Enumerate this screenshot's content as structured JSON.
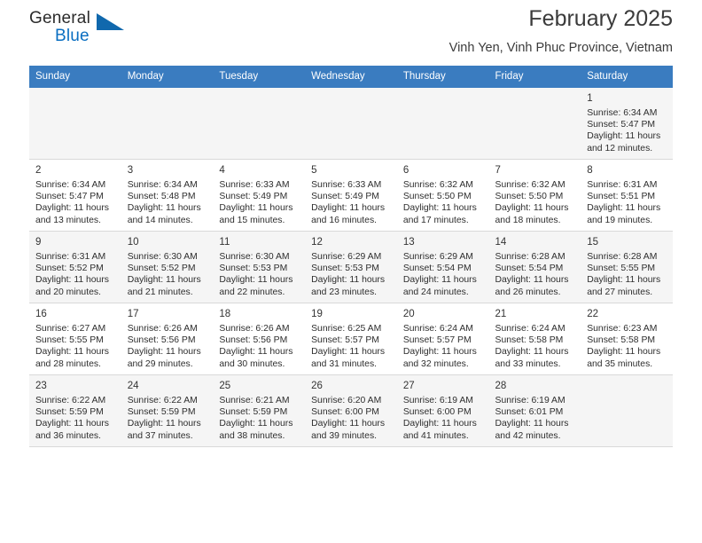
{
  "brand": {
    "name_part1": "General",
    "name_part2": "Blue",
    "accent_color": "#1068ad"
  },
  "header": {
    "title": "February 2025",
    "subtitle": "Vinh Yen, Vinh Phuc Province, Vietnam"
  },
  "calendar": {
    "header_bg": "#3a7cc0",
    "weekdays": [
      "Sunday",
      "Monday",
      "Tuesday",
      "Wednesday",
      "Thursday",
      "Friday",
      "Saturday"
    ],
    "weeks": [
      [
        {
          "day": "",
          "sunrise": "",
          "sunset": "",
          "daylight1": "",
          "daylight2": ""
        },
        {
          "day": "",
          "sunrise": "",
          "sunset": "",
          "daylight1": "",
          "daylight2": ""
        },
        {
          "day": "",
          "sunrise": "",
          "sunset": "",
          "daylight1": "",
          "daylight2": ""
        },
        {
          "day": "",
          "sunrise": "",
          "sunset": "",
          "daylight1": "",
          "daylight2": ""
        },
        {
          "day": "",
          "sunrise": "",
          "sunset": "",
          "daylight1": "",
          "daylight2": ""
        },
        {
          "day": "",
          "sunrise": "",
          "sunset": "",
          "daylight1": "",
          "daylight2": ""
        },
        {
          "day": "1",
          "sunrise": "Sunrise: 6:34 AM",
          "sunset": "Sunset: 5:47 PM",
          "daylight1": "Daylight: 11 hours",
          "daylight2": "and 12 minutes."
        }
      ],
      [
        {
          "day": "2",
          "sunrise": "Sunrise: 6:34 AM",
          "sunset": "Sunset: 5:47 PM",
          "daylight1": "Daylight: 11 hours",
          "daylight2": "and 13 minutes."
        },
        {
          "day": "3",
          "sunrise": "Sunrise: 6:34 AM",
          "sunset": "Sunset: 5:48 PM",
          "daylight1": "Daylight: 11 hours",
          "daylight2": "and 14 minutes."
        },
        {
          "day": "4",
          "sunrise": "Sunrise: 6:33 AM",
          "sunset": "Sunset: 5:49 PM",
          "daylight1": "Daylight: 11 hours",
          "daylight2": "and 15 minutes."
        },
        {
          "day": "5",
          "sunrise": "Sunrise: 6:33 AM",
          "sunset": "Sunset: 5:49 PM",
          "daylight1": "Daylight: 11 hours",
          "daylight2": "and 16 minutes."
        },
        {
          "day": "6",
          "sunrise": "Sunrise: 6:32 AM",
          "sunset": "Sunset: 5:50 PM",
          "daylight1": "Daylight: 11 hours",
          "daylight2": "and 17 minutes."
        },
        {
          "day": "7",
          "sunrise": "Sunrise: 6:32 AM",
          "sunset": "Sunset: 5:50 PM",
          "daylight1": "Daylight: 11 hours",
          "daylight2": "and 18 minutes."
        },
        {
          "day": "8",
          "sunrise": "Sunrise: 6:31 AM",
          "sunset": "Sunset: 5:51 PM",
          "daylight1": "Daylight: 11 hours",
          "daylight2": "and 19 minutes."
        }
      ],
      [
        {
          "day": "9",
          "sunrise": "Sunrise: 6:31 AM",
          "sunset": "Sunset: 5:52 PM",
          "daylight1": "Daylight: 11 hours",
          "daylight2": "and 20 minutes."
        },
        {
          "day": "10",
          "sunrise": "Sunrise: 6:30 AM",
          "sunset": "Sunset: 5:52 PM",
          "daylight1": "Daylight: 11 hours",
          "daylight2": "and 21 minutes."
        },
        {
          "day": "11",
          "sunrise": "Sunrise: 6:30 AM",
          "sunset": "Sunset: 5:53 PM",
          "daylight1": "Daylight: 11 hours",
          "daylight2": "and 22 minutes."
        },
        {
          "day": "12",
          "sunrise": "Sunrise: 6:29 AM",
          "sunset": "Sunset: 5:53 PM",
          "daylight1": "Daylight: 11 hours",
          "daylight2": "and 23 minutes."
        },
        {
          "day": "13",
          "sunrise": "Sunrise: 6:29 AM",
          "sunset": "Sunset: 5:54 PM",
          "daylight1": "Daylight: 11 hours",
          "daylight2": "and 24 minutes."
        },
        {
          "day": "14",
          "sunrise": "Sunrise: 6:28 AM",
          "sunset": "Sunset: 5:54 PM",
          "daylight1": "Daylight: 11 hours",
          "daylight2": "and 26 minutes."
        },
        {
          "day": "15",
          "sunrise": "Sunrise: 6:28 AM",
          "sunset": "Sunset: 5:55 PM",
          "daylight1": "Daylight: 11 hours",
          "daylight2": "and 27 minutes."
        }
      ],
      [
        {
          "day": "16",
          "sunrise": "Sunrise: 6:27 AM",
          "sunset": "Sunset: 5:55 PM",
          "daylight1": "Daylight: 11 hours",
          "daylight2": "and 28 minutes."
        },
        {
          "day": "17",
          "sunrise": "Sunrise: 6:26 AM",
          "sunset": "Sunset: 5:56 PM",
          "daylight1": "Daylight: 11 hours",
          "daylight2": "and 29 minutes."
        },
        {
          "day": "18",
          "sunrise": "Sunrise: 6:26 AM",
          "sunset": "Sunset: 5:56 PM",
          "daylight1": "Daylight: 11 hours",
          "daylight2": "and 30 minutes."
        },
        {
          "day": "19",
          "sunrise": "Sunrise: 6:25 AM",
          "sunset": "Sunset: 5:57 PM",
          "daylight1": "Daylight: 11 hours",
          "daylight2": "and 31 minutes."
        },
        {
          "day": "20",
          "sunrise": "Sunrise: 6:24 AM",
          "sunset": "Sunset: 5:57 PM",
          "daylight1": "Daylight: 11 hours",
          "daylight2": "and 32 minutes."
        },
        {
          "day": "21",
          "sunrise": "Sunrise: 6:24 AM",
          "sunset": "Sunset: 5:58 PM",
          "daylight1": "Daylight: 11 hours",
          "daylight2": "and 33 minutes."
        },
        {
          "day": "22",
          "sunrise": "Sunrise: 6:23 AM",
          "sunset": "Sunset: 5:58 PM",
          "daylight1": "Daylight: 11 hours",
          "daylight2": "and 35 minutes."
        }
      ],
      [
        {
          "day": "23",
          "sunrise": "Sunrise: 6:22 AM",
          "sunset": "Sunset: 5:59 PM",
          "daylight1": "Daylight: 11 hours",
          "daylight2": "and 36 minutes."
        },
        {
          "day": "24",
          "sunrise": "Sunrise: 6:22 AM",
          "sunset": "Sunset: 5:59 PM",
          "daylight1": "Daylight: 11 hours",
          "daylight2": "and 37 minutes."
        },
        {
          "day": "25",
          "sunrise": "Sunrise: 6:21 AM",
          "sunset": "Sunset: 5:59 PM",
          "daylight1": "Daylight: 11 hours",
          "daylight2": "and 38 minutes."
        },
        {
          "day": "26",
          "sunrise": "Sunrise: 6:20 AM",
          "sunset": "Sunset: 6:00 PM",
          "daylight1": "Daylight: 11 hours",
          "daylight2": "and 39 minutes."
        },
        {
          "day": "27",
          "sunrise": "Sunrise: 6:19 AM",
          "sunset": "Sunset: 6:00 PM",
          "daylight1": "Daylight: 11 hours",
          "daylight2": "and 41 minutes."
        },
        {
          "day": "28",
          "sunrise": "Sunrise: 6:19 AM",
          "sunset": "Sunset: 6:01 PM",
          "daylight1": "Daylight: 11 hours",
          "daylight2": "and 42 minutes."
        },
        {
          "day": "",
          "sunrise": "",
          "sunset": "",
          "daylight1": "",
          "daylight2": ""
        }
      ]
    ]
  }
}
